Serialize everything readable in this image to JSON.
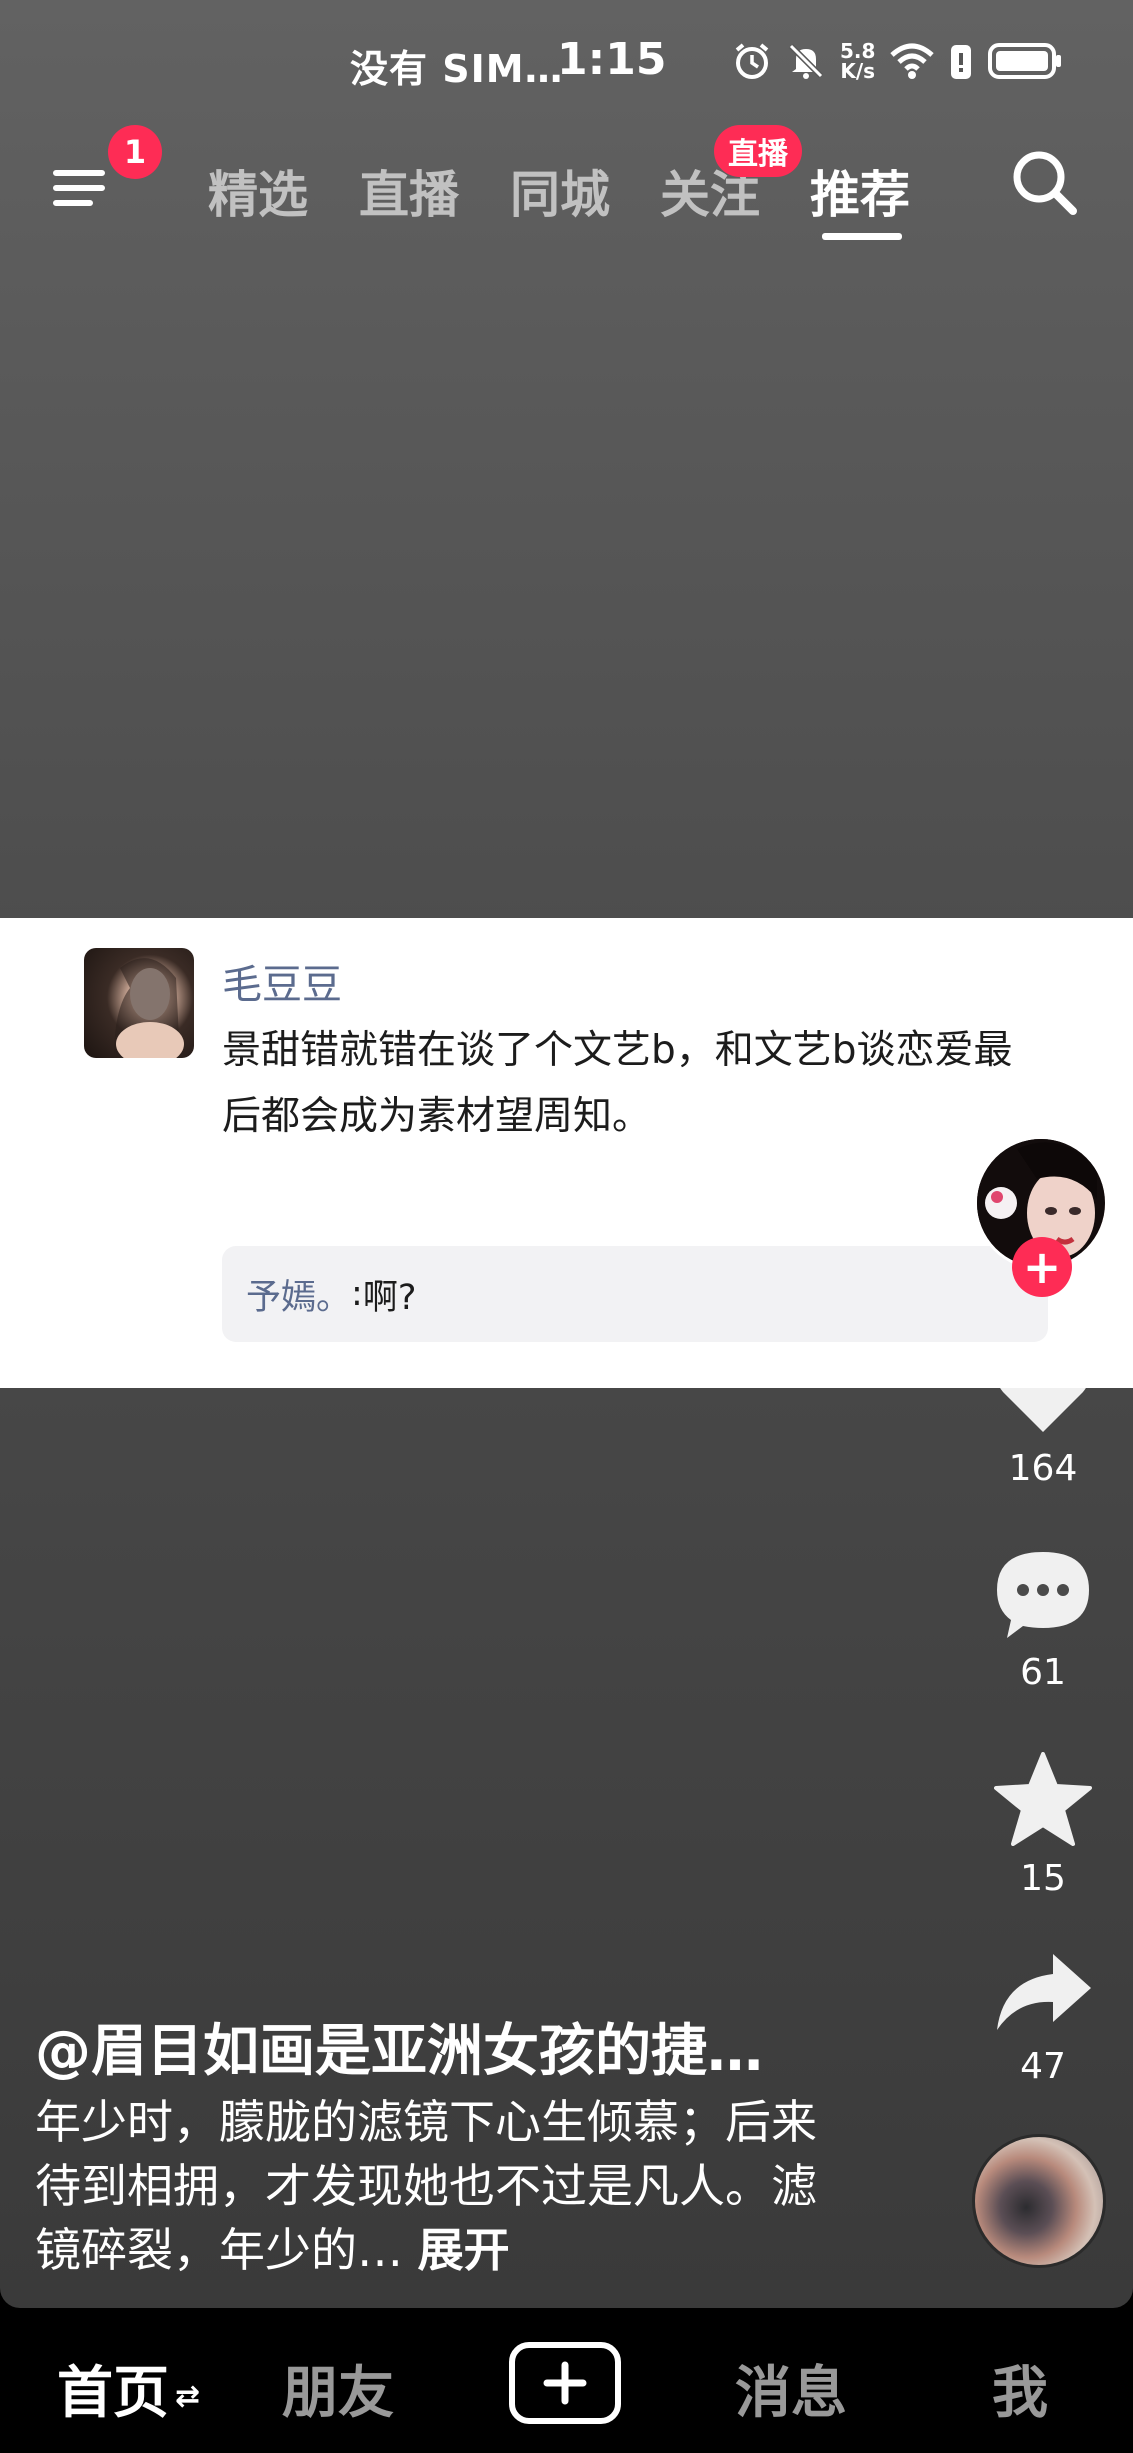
{
  "status_bar": {
    "carrier": "没有 SIM…",
    "time": "1:15",
    "net_speed_value": "5.8",
    "net_speed_unit": "K/s",
    "icons": [
      "alarm-icon",
      "mute-icon",
      "wifi-icon",
      "battery-saver-icon",
      "battery-icon"
    ]
  },
  "top_nav": {
    "menu_badge": "1",
    "tabs": [
      {
        "label": "精选"
      },
      {
        "label": "直播"
      },
      {
        "label": "同城"
      },
      {
        "label": "关注"
      },
      {
        "label": "推荐"
      }
    ],
    "active_tab": "推荐",
    "live_badge": "直播"
  },
  "comment_card": {
    "user": "毛豆豆",
    "text": "景甜错就错在谈了个文艺b，和文艺b谈恋爱最后都会成为素材望周知。",
    "reply_user": "予嫣。",
    "reply_sep": ": ",
    "reply_text": "啊?"
  },
  "side_actions": {
    "likes": "164",
    "comments": "61",
    "favorites": "15",
    "shares": "47"
  },
  "caption": {
    "user": "@眉目如画是亚洲女孩的捷…",
    "desc": "年少时，朦胧的滤镜下心生倾慕；后来待到相拥，才发现她也不过是凡人。滤镜碎裂，年少的…",
    "expand": "展开"
  },
  "bottom_nav": {
    "home": "首页",
    "swap_symbol": "⇄",
    "friends": "朋友",
    "messages": "消息",
    "me": "我"
  },
  "colors": {
    "accent": "#fe2c55",
    "username": "#5b6b8e"
  }
}
